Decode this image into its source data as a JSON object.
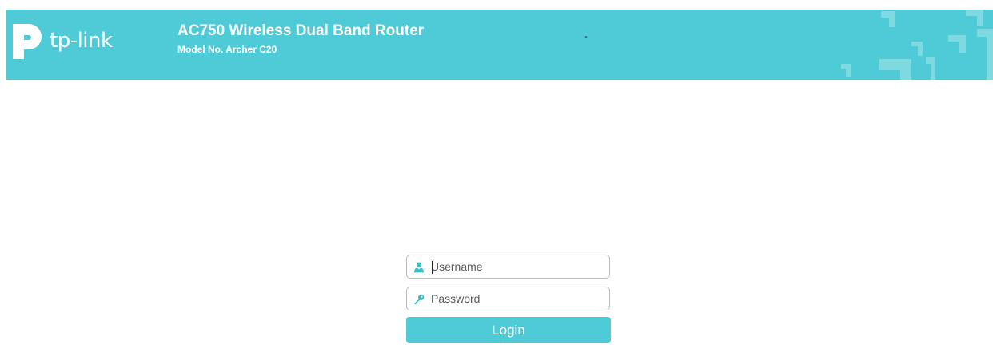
{
  "theme": {
    "accent": "#4ecbd6",
    "icon_color": "#3bbdc9"
  },
  "header": {
    "logo_text": "tp-link",
    "product_title": "AC750 Wireless Dual Band Router",
    "model_number": "Model No. Archer C20"
  },
  "login": {
    "username": {
      "placeholder": "Username",
      "value": "",
      "icon": "user-icon"
    },
    "password": {
      "placeholder": "Password",
      "value": "",
      "icon": "key-icon"
    },
    "button_label": "Login"
  }
}
